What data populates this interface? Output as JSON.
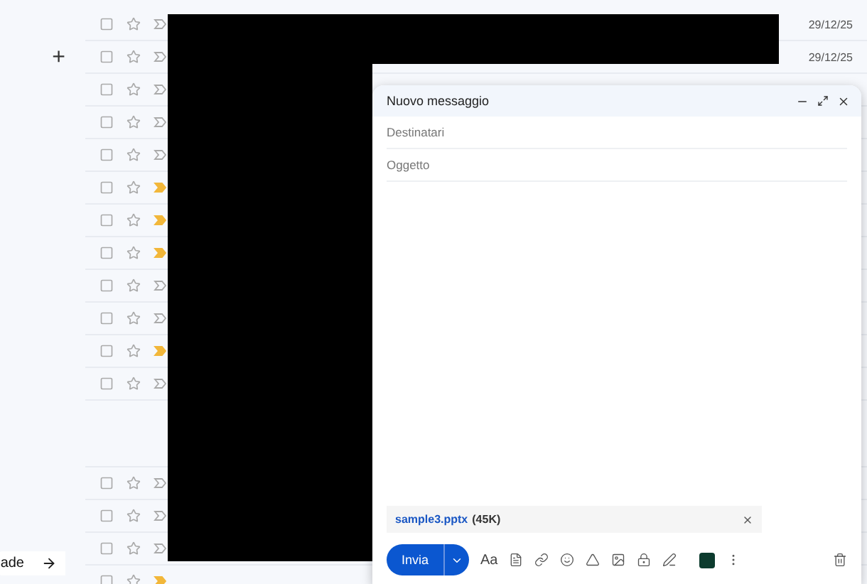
{
  "sidebar": {
    "compose_symbol": "+",
    "upgrade_label": "ade"
  },
  "rows": [
    {
      "kind": "mail",
      "checked": false,
      "starred": false,
      "important": false,
      "date": "29/12/25"
    },
    {
      "kind": "mail",
      "checked": false,
      "starred": false,
      "important": false,
      "date": "29/12/25"
    },
    {
      "kind": "mail",
      "checked": false,
      "starred": false,
      "important": false
    },
    {
      "kind": "mail",
      "checked": false,
      "starred": false,
      "important": false
    },
    {
      "kind": "mail",
      "checked": false,
      "starred": false,
      "important": false
    },
    {
      "kind": "mail",
      "checked": false,
      "starred": false,
      "important": true
    },
    {
      "kind": "mail",
      "checked": false,
      "starred": false,
      "important": true
    },
    {
      "kind": "mail",
      "checked": false,
      "starred": false,
      "important": true
    },
    {
      "kind": "mail",
      "checked": false,
      "starred": false,
      "important": false
    },
    {
      "kind": "mail",
      "checked": false,
      "starred": false,
      "important": false
    },
    {
      "kind": "mail",
      "checked": false,
      "starred": false,
      "important": true
    },
    {
      "kind": "mail",
      "checked": false,
      "starred": false,
      "important": false
    },
    {
      "kind": "gap"
    },
    {
      "kind": "mail",
      "checked": false,
      "starred": false,
      "important": false
    },
    {
      "kind": "mail",
      "checked": false,
      "starred": false,
      "important": false
    },
    {
      "kind": "mail",
      "checked": false,
      "starred": false,
      "important": false
    },
    {
      "kind": "mail",
      "checked": false,
      "starred": false,
      "important": true
    }
  ],
  "compose": {
    "title": "Nuovo messaggio",
    "to_placeholder": "Destinatari",
    "subject_placeholder": "Oggetto",
    "attachment": {
      "name": "sample3.pptx",
      "size": "(45K)"
    },
    "send_label": "Invia",
    "format_label": "Aa"
  }
}
